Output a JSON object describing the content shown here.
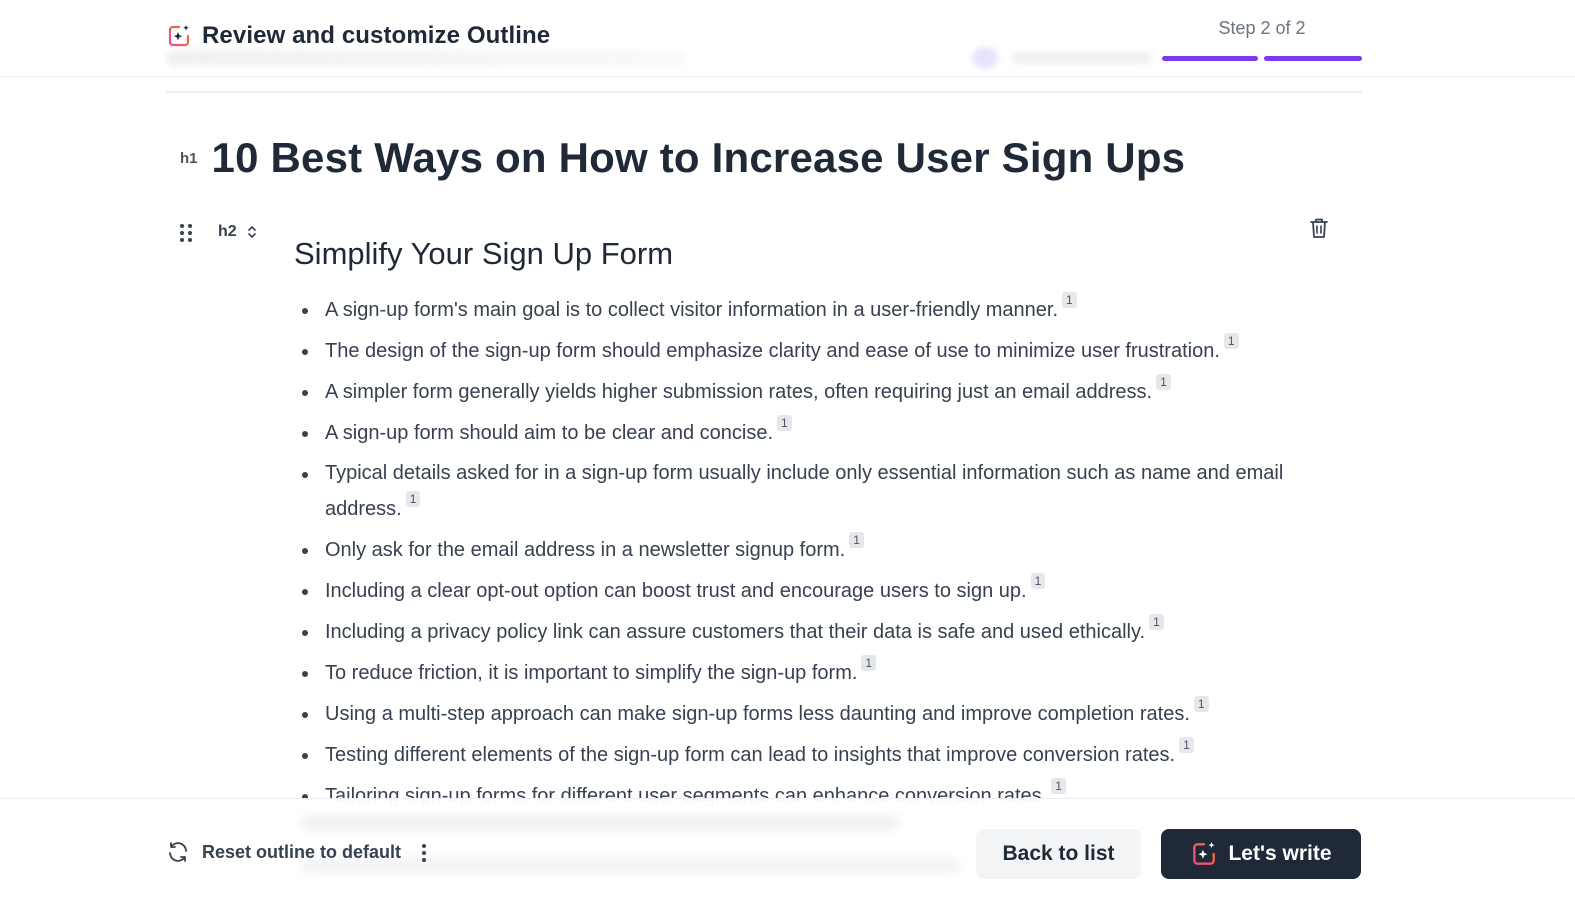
{
  "header": {
    "title": "Review and customize Outline",
    "title_icon": "sparkle-doc-icon",
    "step_text": "Step 2 of 2",
    "step_current": 2,
    "step_total": 2,
    "accent_color": "#7c3aed"
  },
  "outline": {
    "h1": {
      "tag": "h1",
      "title": "10 Best Ways on How to Increase User Sign Ups"
    },
    "section": {
      "tag": "h2",
      "title": "Simplify Your Sign Up Form",
      "bullets": [
        {
          "text": "A sign-up form's main goal is to collect visitor information in a user-friendly manner.",
          "cite": "1"
        },
        {
          "text": "The design of the sign-up form should emphasize clarity and ease of use to minimize user frustration.",
          "cite": "1"
        },
        {
          "text": "A simpler form generally yields higher submission rates, often requiring just an email address.",
          "cite": "1"
        },
        {
          "text": "A sign-up form should aim to be clear and concise.",
          "cite": "1"
        },
        {
          "text": "Typical details asked for in a sign-up form usually include only essential information such as name and email address.",
          "cite": "1"
        },
        {
          "text": "Only ask for the email address in a newsletter signup form.",
          "cite": "1"
        },
        {
          "text": "Including a clear opt-out option can boost trust and encourage users to sign up.",
          "cite": "1"
        },
        {
          "text": "Including a privacy policy link can assure customers that their data is safe and used ethically.",
          "cite": "1"
        },
        {
          "text": "To reduce friction, it is important to simplify the sign-up form.",
          "cite": "1"
        },
        {
          "text": "Using a multi-step approach can make sign-up forms less daunting and improve completion rates.",
          "cite": "1"
        },
        {
          "text": "Testing different elements of the sign-up form can lead to insights that improve conversion rates.",
          "cite": "1"
        },
        {
          "text": "Tailoring sign-up forms for different user segments can enhance conversion rates.",
          "cite": "1"
        }
      ]
    }
  },
  "footer": {
    "reset_label": "Reset outline to default",
    "back_label": "Back to list",
    "write_label": "Let's write",
    "primary_button_color": "#1f2937"
  }
}
